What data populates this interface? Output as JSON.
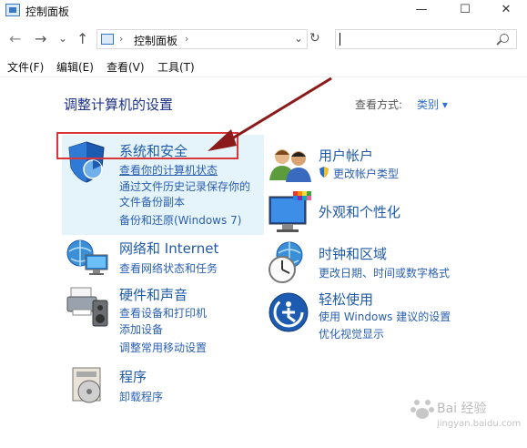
{
  "window": {
    "title": "控制面板",
    "minimize": "—",
    "maximize": "☐",
    "close": "✕"
  },
  "navigation": {
    "back": "←",
    "forward": "→",
    "recent": "⌄",
    "up": "↑",
    "address_separator": "›",
    "address_path": "控制面板",
    "address_dropdown": "⌄",
    "refresh": "↻",
    "search_placeholder": ""
  },
  "menubar": {
    "items": [
      "文件(F)",
      "编辑(E)",
      "查看(V)",
      "工具(T)"
    ]
  },
  "content": {
    "heading": "调整计算机的设置",
    "view_by_label": "查看方式:",
    "view_by_value": "类别 ▾",
    "categories": [
      {
        "title": "系统和安全",
        "links": [
          "查看你的计算机状态",
          "通过文件历史记录保存你的",
          "文件备份副本",
          "备份和还原(Windows 7)"
        ]
      },
      {
        "title": "网络和 Internet",
        "links": [
          "查看网络状态和任务"
        ]
      },
      {
        "title": "硬件和声音",
        "links": [
          "查看设备和打印机",
          "添加设备",
          "调整常用移动设置"
        ]
      },
      {
        "title": "程序",
        "links": [
          "卸载程序"
        ]
      },
      {
        "title": "用户帐户",
        "links": [
          "更改帐户类型"
        ]
      },
      {
        "title": "外观和个性化",
        "links": []
      },
      {
        "title": "时钟和区域",
        "links": [
          "更改日期、时间或数字格式"
        ]
      },
      {
        "title": "轻松使用",
        "links": [
          "使用 Windows 建议的设置",
          "优化视觉显示"
        ]
      }
    ]
  },
  "annotation": {
    "arrow_color": "#8b1a1a",
    "box_color": "#d9363b"
  },
  "watermark": {
    "text": "Bai 经验",
    "url": "jingyan.baidu.com"
  }
}
